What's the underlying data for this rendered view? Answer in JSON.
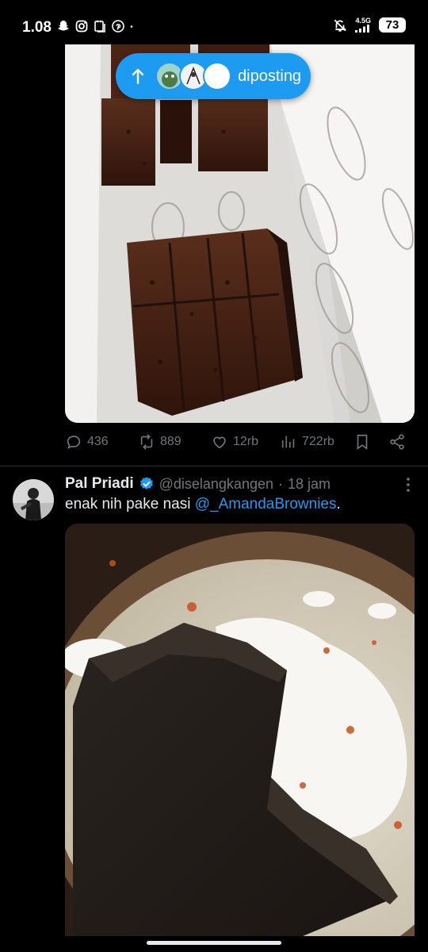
{
  "status_bar": {
    "time": "1.08",
    "network": "4.5G",
    "battery": "73",
    "icons": [
      "snapchat-icon",
      "instagram-icon",
      "notes-icon",
      "pinterest-icon",
      "dot-icon",
      "mute-icon",
      "signal-icon"
    ]
  },
  "posted_pill": {
    "label": "diposting",
    "icon": "arrow-up-icon",
    "avatar_count": 3
  },
  "tweet1": {
    "replies": "436",
    "reposts": "889",
    "likes": "12rb",
    "views": "722rb"
  },
  "tweet2": {
    "display_name": "Pal Priadi",
    "handle": "@diselangkangen",
    "separator": "·",
    "time": "18 jam",
    "text_prefix": "enak nih pake nasi ",
    "mention": "@_AmandaBrownies",
    "text_suffix": "."
  },
  "colors": {
    "background": "#000000",
    "accent": "#1d9bf0",
    "muted": "#71767b",
    "text": "#e7e9ea"
  }
}
